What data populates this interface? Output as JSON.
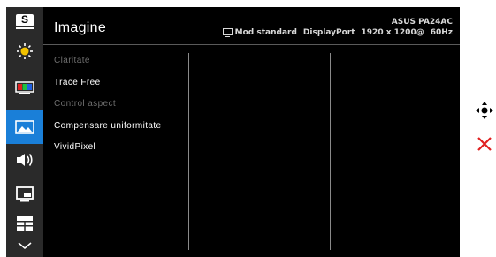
{
  "header": {
    "title": "Imagine",
    "model": "ASUS PA24AC",
    "mode": "Mod standard",
    "input": "DisplayPort",
    "resolution": "1920 x 1200@",
    "refresh": "60Hz"
  },
  "sidebar": {
    "top_logo": "S",
    "items": [
      {
        "icon": "brightness-icon"
      },
      {
        "icon": "color-icon"
      },
      {
        "icon": "image-icon",
        "active": true
      },
      {
        "icon": "sound-icon"
      },
      {
        "icon": "pip-icon"
      },
      {
        "icon": "quickfit-icon"
      },
      {
        "icon": "chevron-down-icon"
      }
    ]
  },
  "menu": [
    {
      "label": "Claritate",
      "enabled": false
    },
    {
      "label": "Trace Free",
      "enabled": true
    },
    {
      "label": "Control aspect",
      "enabled": false
    },
    {
      "label": "Compensare uniformitate",
      "enabled": true
    },
    {
      "label": "VividPixel",
      "enabled": true
    }
  ],
  "colors": {
    "accent": "#1a7fd8",
    "close": "#e02020"
  }
}
